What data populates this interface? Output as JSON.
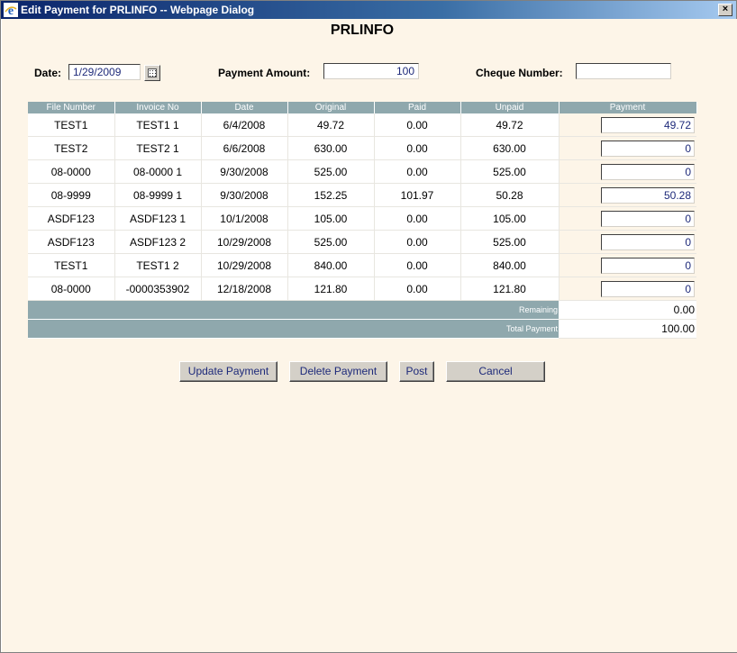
{
  "window": {
    "title": "Edit Payment for PRLINFO -- Webpage Dialog",
    "close_glyph": "×"
  },
  "page": {
    "heading": "PRLINFO"
  },
  "form": {
    "date_label": "Date:",
    "date_value": "1/29/2009",
    "payment_amount_label": "Payment Amount:",
    "payment_amount_value": "100",
    "cheque_number_label": "Cheque Number:",
    "cheque_number_value": ""
  },
  "table": {
    "headers": [
      "File Number",
      "Invoice No",
      "Date",
      "Original",
      "Paid",
      "Unpaid",
      "Payment"
    ],
    "rows": [
      {
        "file": "TEST1",
        "invoice": "TEST1 1",
        "date": "6/4/2008",
        "original": "49.72",
        "paid": "0.00",
        "unpaid": "49.72",
        "payment": "49.72"
      },
      {
        "file": "TEST2",
        "invoice": "TEST2 1",
        "date": "6/6/2008",
        "original": "630.00",
        "paid": "0.00",
        "unpaid": "630.00",
        "payment": "0"
      },
      {
        "file": "08-0000",
        "invoice": "08-0000 1",
        "date": "9/30/2008",
        "original": "525.00",
        "paid": "0.00",
        "unpaid": "525.00",
        "payment": "0"
      },
      {
        "file": "08-9999",
        "invoice": "08-9999 1",
        "date": "9/30/2008",
        "original": "152.25",
        "paid": "101.97",
        "unpaid": "50.28",
        "payment": "50.28"
      },
      {
        "file": "ASDF123",
        "invoice": "ASDF123 1",
        "date": "10/1/2008",
        "original": "105.00",
        "paid": "0.00",
        "unpaid": "105.00",
        "payment": "0"
      },
      {
        "file": "ASDF123",
        "invoice": "ASDF123 2",
        "date": "10/29/2008",
        "original": "525.00",
        "paid": "0.00",
        "unpaid": "525.00",
        "payment": "0"
      },
      {
        "file": "TEST1",
        "invoice": "TEST1 2",
        "date": "10/29/2008",
        "original": "840.00",
        "paid": "0.00",
        "unpaid": "840.00",
        "payment": "0"
      },
      {
        "file": "08-0000",
        "invoice": "-0000353902",
        "date": "12/18/2008",
        "original": "121.80",
        "paid": "0.00",
        "unpaid": "121.80",
        "payment": "0"
      }
    ],
    "remaining_label": "Remaining",
    "remaining_value": "0.00",
    "total_label": "Total Payment",
    "total_value": "100.00"
  },
  "buttons": {
    "update": "Update Payment",
    "delete": "Delete Payment",
    "post": "Post",
    "cancel": "Cancel"
  },
  "colors": {
    "background": "#fdf5e8",
    "header": "#8fa8ad",
    "titlebar": "#0a246a",
    "input_text": "#1e2a7a"
  }
}
